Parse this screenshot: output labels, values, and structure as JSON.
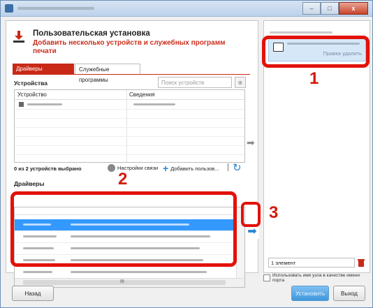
{
  "window": {
    "controls": [
      "–",
      "□",
      "x"
    ]
  },
  "header": {
    "title": "Пользовательская установка",
    "subtitle": "Добавить несколько устройств и служебных программ печати"
  },
  "tabs": [
    {
      "label": "Драйверы",
      "active": true
    },
    {
      "label": "Служебные программы",
      "active": false
    }
  ],
  "devices": {
    "section_label": "Устройства",
    "search_placeholder": "Поиск устройств",
    "columns": [
      "Устройство",
      "Сведения"
    ],
    "count_text": "0 из 2 устройств выбрано",
    "connect_label": "Настройки связи",
    "add_label": "Добавить пользов..."
  },
  "drivers": {
    "section_label": "Драйверы",
    "scroll_marker": "III"
  },
  "selected": {
    "actions": "Правка  удалить",
    "count_text": "1 элемент"
  },
  "option_label": "Использовать имя узла в качестве имени порта",
  "buttons": {
    "back": "Назад",
    "install": "Установить",
    "exit": "Выход"
  },
  "callouts": [
    "1",
    "2",
    "3"
  ],
  "colors": {
    "accent_red": "#c82916",
    "callout_red": "#e2120a",
    "selection_blue": "#3399ff",
    "arrow_blue": "#2a84cf"
  }
}
